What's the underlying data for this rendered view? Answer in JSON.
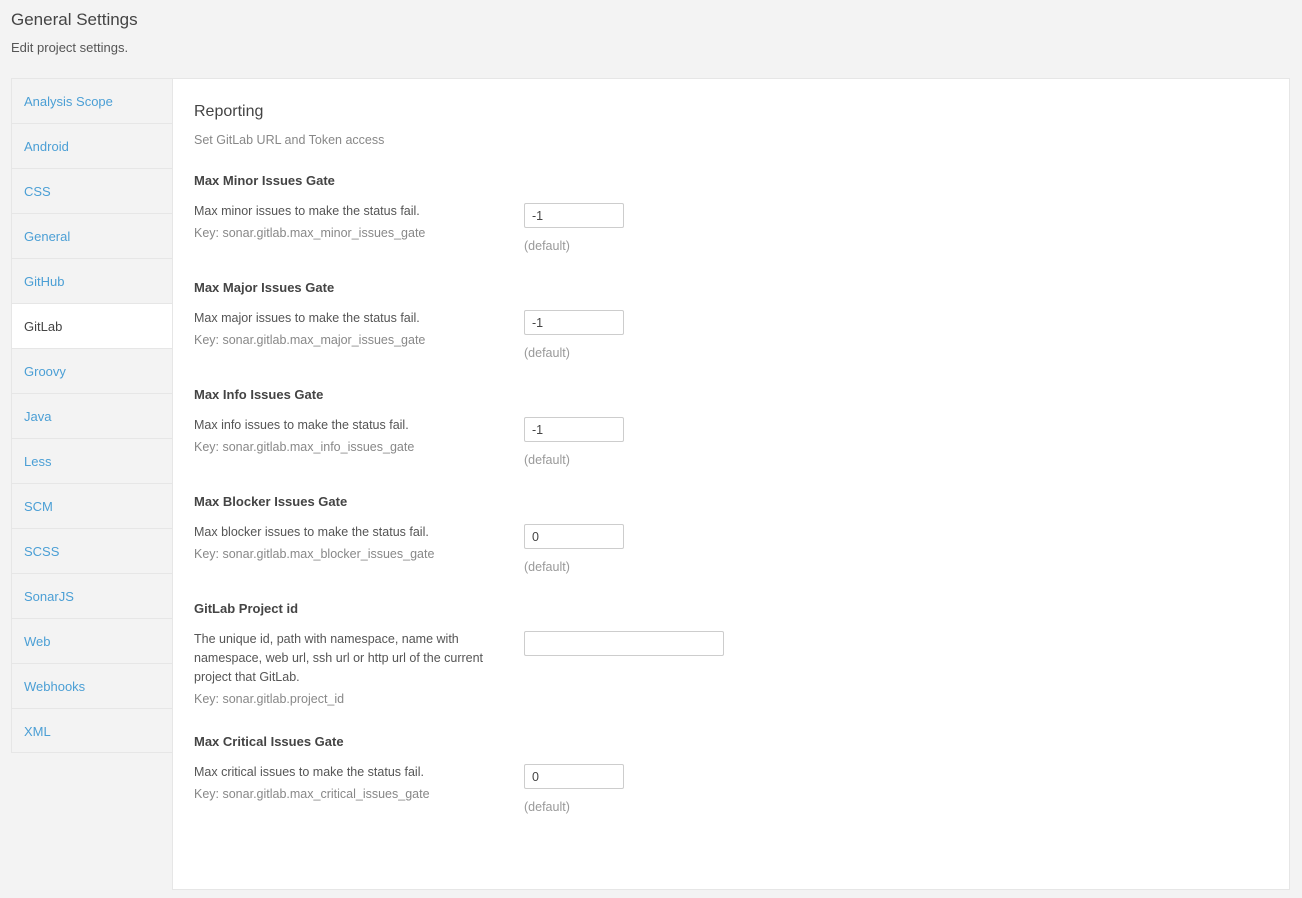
{
  "header": {
    "title": "General Settings",
    "subtitle": "Edit project settings."
  },
  "sidebar": {
    "items": [
      {
        "label": "Analysis Scope",
        "active": false
      },
      {
        "label": "Android",
        "active": false
      },
      {
        "label": "CSS",
        "active": false
      },
      {
        "label": "General",
        "active": false
      },
      {
        "label": "GitHub",
        "active": false
      },
      {
        "label": "GitLab",
        "active": true
      },
      {
        "label": "Groovy",
        "active": false
      },
      {
        "label": "Java",
        "active": false
      },
      {
        "label": "Less",
        "active": false
      },
      {
        "label": "SCM",
        "active": false
      },
      {
        "label": "SCSS",
        "active": false
      },
      {
        "label": "SonarJS",
        "active": false
      },
      {
        "label": "Web",
        "active": false
      },
      {
        "label": "Webhooks",
        "active": false
      },
      {
        "label": "XML",
        "active": false
      }
    ]
  },
  "panel": {
    "title": "Reporting",
    "subtitle": "Set GitLab URL and Token access",
    "default_label": "(default)",
    "settings": [
      {
        "name": "Max Minor Issues Gate",
        "description": "Max minor issues to make the status fail.",
        "key": "Key: sonar.gitlab.max_minor_issues_gate",
        "value": "-1",
        "placeholder": "",
        "wide": false,
        "default_label": "(default)"
      },
      {
        "name": "Max Major Issues Gate",
        "description": "Max major issues to make the status fail.",
        "key": "Key: sonar.gitlab.max_major_issues_gate",
        "value": "-1",
        "placeholder": "",
        "wide": false,
        "default_label": "(default)"
      },
      {
        "name": "Max Info Issues Gate",
        "description": "Max info issues to make the status fail.",
        "key": "Key: sonar.gitlab.max_info_issues_gate",
        "value": "-1",
        "placeholder": "",
        "wide": false,
        "default_label": "(default)"
      },
      {
        "name": "Max Blocker Issues Gate",
        "description": "Max blocker issues to make the status fail.",
        "key": "Key: sonar.gitlab.max_blocker_issues_gate",
        "value": "0",
        "placeholder": "",
        "wide": false,
        "default_label": "(default)"
      },
      {
        "name": "GitLab Project id",
        "description": "The unique id, path with namespace, name with namespace, web url, ssh url or http url of the current project that GitLab.",
        "key": "Key: sonar.gitlab.project_id",
        "value": "",
        "placeholder": "",
        "wide": true,
        "default_label": ""
      },
      {
        "name": "Max Critical Issues Gate",
        "description": "Max critical issues to make the status fail.",
        "key": "Key: sonar.gitlab.max_critical_issues_gate",
        "value": "0",
        "placeholder": "",
        "wide": false,
        "default_label": "(default)"
      }
    ]
  },
  "colors": {
    "background": "#f3f3f3",
    "panel": "#ffffff",
    "link": "#4b9fd5",
    "border": "#e6e6e6",
    "text": "#444444",
    "muted": "#888888"
  }
}
